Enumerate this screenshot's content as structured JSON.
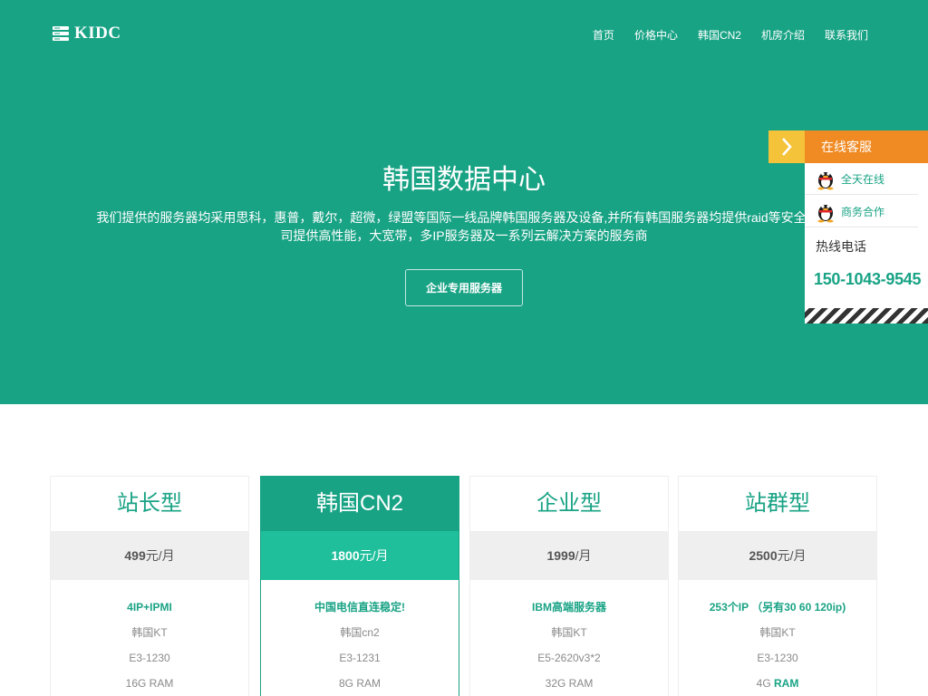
{
  "header": {
    "logo_text": "KIDC",
    "logo_icon": "server-icon",
    "nav": [
      {
        "label": "首页"
      },
      {
        "label": "价格中心"
      },
      {
        "label": "韩国CN2"
      },
      {
        "label": "机房介绍"
      },
      {
        "label": "联系我们"
      }
    ]
  },
  "hero": {
    "title": "韩国数据中心",
    "desc_line1": "我们提供的服务器均采用思科，惠普，戴尔，超微，绿盟等国际一线品牌韩国服务器及设备,并所有韩国服务器均提供raid等安全措施",
    "desc_line2": "司提供高性能，大宽带，多IP服务器及一系列云解决方案的服务商",
    "cta_label": "企业专用服务器"
  },
  "service": {
    "title": "在线客服",
    "toggle_icon": "chevron-right-icon",
    "contacts": [
      {
        "label": "全天在线",
        "icon": "qq-icon"
      },
      {
        "label": "商务合作",
        "icon": "qq-icon"
      }
    ],
    "hotline_label": "热线电话",
    "hotline_number": "150-1043-9545"
  },
  "plans": [
    {
      "title": "站长型",
      "price": "499",
      "unit": "元/月",
      "highlight": "4IP+IPMI",
      "features": [
        "韩国KT",
        "E3-1230",
        "16G RAM"
      ]
    },
    {
      "title": "韩国CN2",
      "price": "1800",
      "unit": "元/月",
      "highlight": "中国电信直连稳定!",
      "features": [
        "韩国cn2",
        "E3-1231",
        "8G RAM"
      ]
    },
    {
      "title": "企业型",
      "price": "1999",
      "unit": "/月",
      "highlight": "IBM高端服务器",
      "features": [
        "韩国KT",
        "E5-2620v3*2",
        "32G RAM"
      ]
    },
    {
      "title": "站群型",
      "price": "2500",
      "unit": "元/月",
      "highlight": "253个IP （另有30 60 120ip)",
      "features": [
        "韩国KT",
        "E3-1230"
      ],
      "ram_prefix": "4G ",
      "ram_hl": "RAM"
    }
  ],
  "colors": {
    "brand": "#19a385",
    "brand_light": "#1fbf9c",
    "service_orange": "#f08a22",
    "service_yellow": "#f5c33a"
  }
}
